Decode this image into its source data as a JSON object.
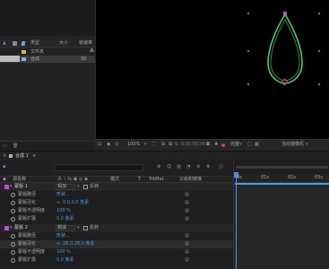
{
  "project": {
    "columns": {
      "type": "类型",
      "size": "大小",
      "frame_rate": "帧速率"
    },
    "items": [
      {
        "type": "文件夹",
        "size": ""
      },
      {
        "type": "合成",
        "size": "30"
      }
    ]
  },
  "viewer": {
    "zoom": "100%",
    "timecode": "0:00:00:00",
    "resolution": "完整",
    "camera": "活动摄像机"
  },
  "timeline": {
    "tab_label": "合成 1",
    "columns": {
      "source_name": "源名称",
      "mode": "模式",
      "t": "T",
      "trkmat": "TrkMat",
      "parent": "父级和链接"
    },
    "ruler": [
      "0s",
      "01s",
      "02s",
      "03s"
    ],
    "layers": [
      {
        "num": "1",
        "name": "蒙版 1",
        "mode": "相加",
        "inverted": "反转",
        "props": [
          {
            "name": "蒙版路径",
            "value": "形状..."
          },
          {
            "name": "蒙版羽化",
            "value": "0.0,0.0 像素"
          },
          {
            "name": "蒙版不透明度",
            "value": "100 %"
          },
          {
            "name": "蒙版扩展",
            "value": "0.0 像素"
          }
        ]
      },
      {
        "num": "2",
        "name": "蒙版 2",
        "mode": "相减",
        "inverted": "反转",
        "props": [
          {
            "name": "蒙版路径",
            "value": "形状..."
          },
          {
            "name": "蒙版羽化",
            "value": "28.0,28.0 像素"
          },
          {
            "name": "蒙版不透明度",
            "value": "100 %"
          },
          {
            "name": "蒙版扩展",
            "value": "0.0 像素"
          }
        ]
      }
    ]
  },
  "colors": {
    "label_purple": "#b84fd4",
    "mask_green": "#3cd070",
    "handle_red": "#e0405a",
    "time_blue": "#4a90d9"
  }
}
